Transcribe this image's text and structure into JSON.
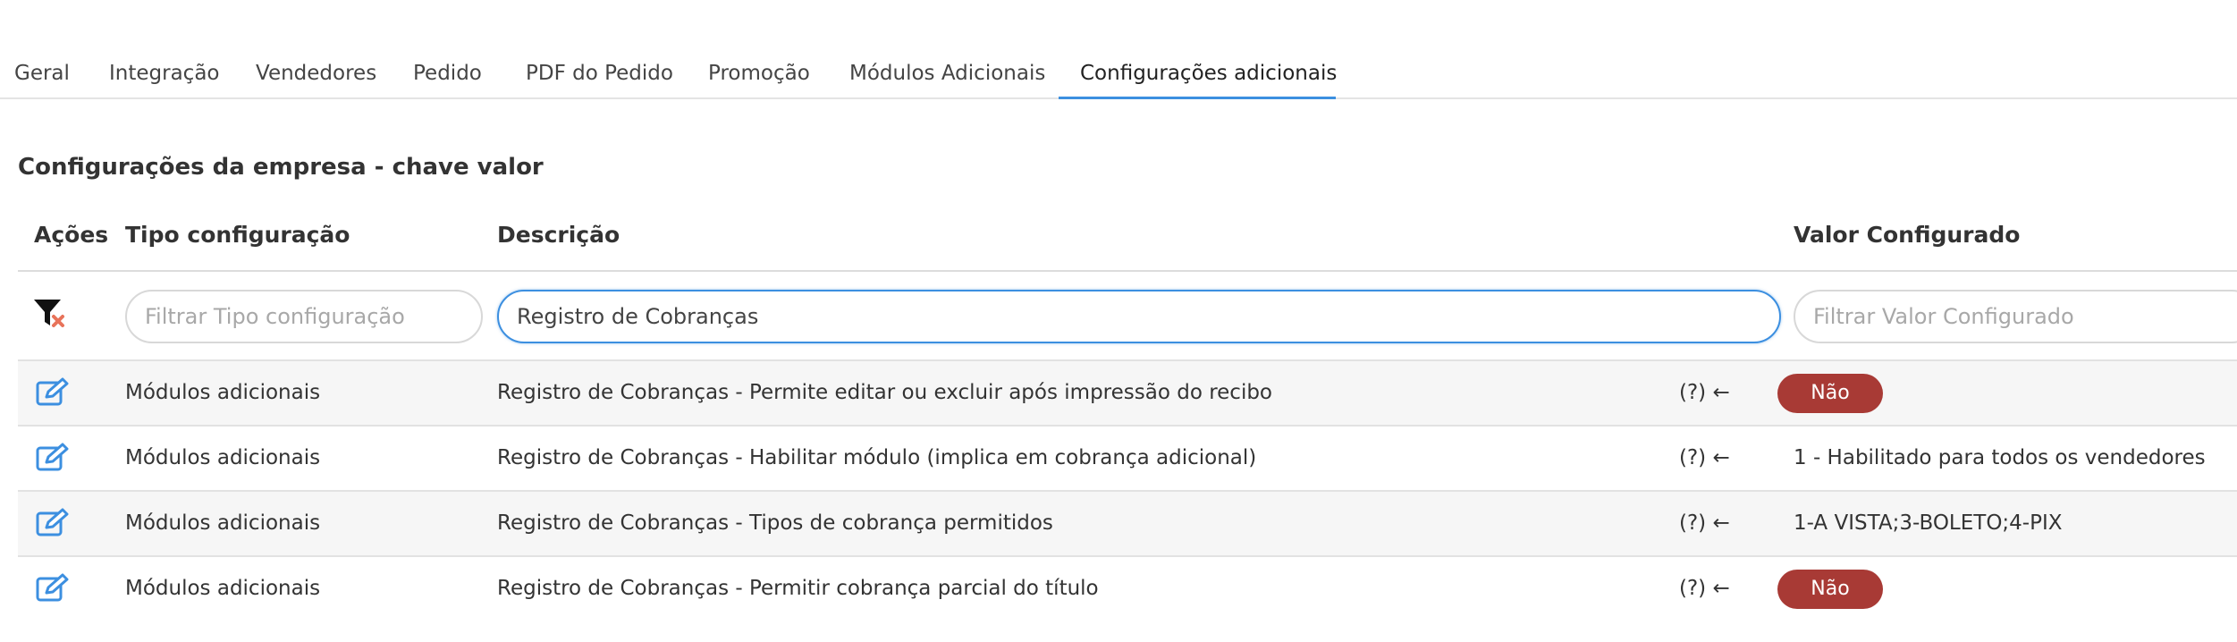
{
  "tabs": [
    {
      "label": "Geral"
    },
    {
      "label": "Integração"
    },
    {
      "label": "Vendedores"
    },
    {
      "label": "Pedido"
    },
    {
      "label": "PDF do Pedido"
    },
    {
      "label": "Promoção"
    },
    {
      "label": "Módulos Adicionais"
    },
    {
      "label": "Configurações adicionais",
      "active": true
    }
  ],
  "section": {
    "title": "Configurações da empresa - chave valor"
  },
  "table": {
    "headers": {
      "acoes": "Ações",
      "tipo": "Tipo configuração",
      "descricao": "Descrição",
      "valor": "Valor Configurado"
    },
    "filters": {
      "tipo_placeholder": "Filtrar Tipo configuração",
      "descricao_value": "Registro de Cobranças",
      "valor_placeholder": "Filtrar Valor Configurado"
    },
    "help_label": "(?) ←",
    "rows": [
      {
        "tipo": "Módulos adicionais",
        "descricao": "Registro de Cobranças - Permite editar ou excluir após impressão do recibo",
        "valor": "Não",
        "valor_is_badge": true
      },
      {
        "tipo": "Módulos adicionais",
        "descricao": "Registro de Cobranças -  Habilitar módulo (implica em cobrança adicional)",
        "valor": "1 - Habilitado para todos os vendedores",
        "valor_is_badge": false
      },
      {
        "tipo": "Módulos adicionais",
        "descricao": "Registro de Cobranças - Tipos de cobrança permitidos",
        "valor": "1-A VISTA;3-BOLETO;4-PIX",
        "valor_is_badge": false
      },
      {
        "tipo": "Módulos adicionais",
        "descricao": "Registro de Cobranças - Permitir cobrança parcial do título",
        "valor": "Não",
        "valor_is_badge": true
      }
    ]
  },
  "icons": {
    "filter_clear": "filter-clear-icon",
    "edit": "edit-icon"
  },
  "colors": {
    "accent": "#3c8fe0",
    "badge_no": "#a83a35",
    "row_stripe": "#f6f6f6",
    "filter_clear_x": "#e8735a"
  }
}
